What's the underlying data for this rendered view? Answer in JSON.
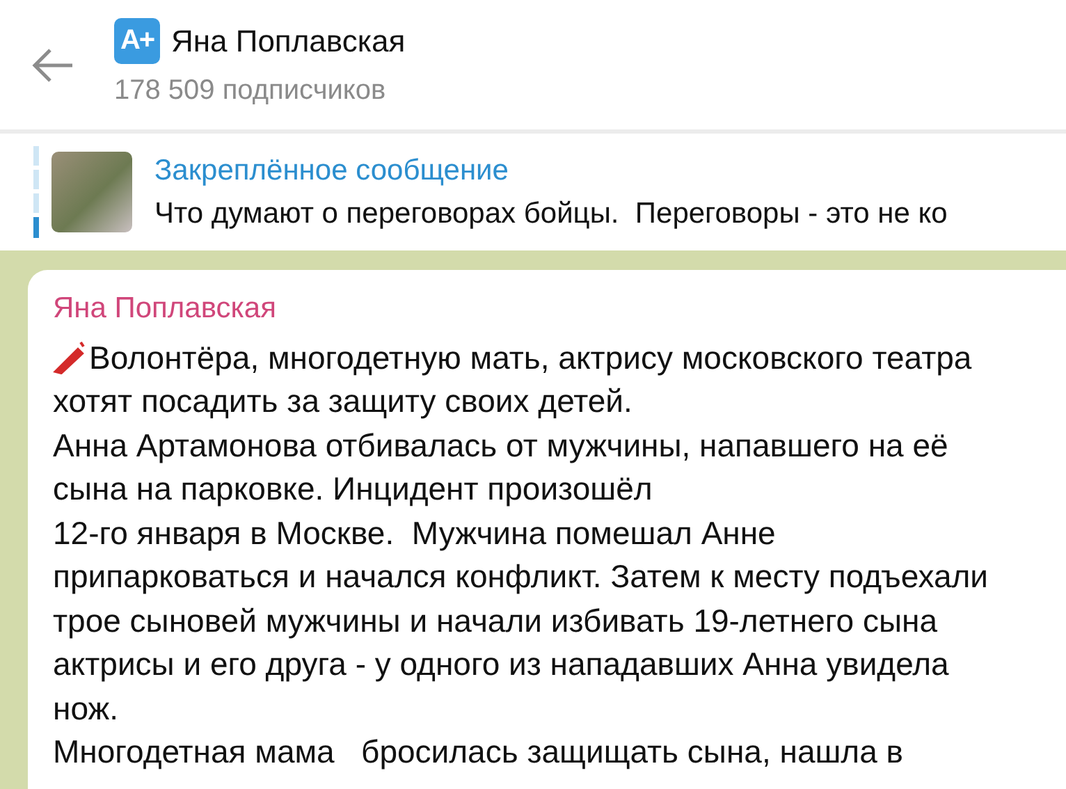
{
  "header": {
    "logo_text": "A+",
    "title": "Яна Поплавская",
    "subtitle": "178 509 подписчиков"
  },
  "pinned": {
    "label": "Закреплённое сообщение",
    "text": "Что думают о переговорах бойцы.  Переговоры - это не ко"
  },
  "message": {
    "author": "Яна Поплавская",
    "lines": [
      "Волонтёра, многодетную мать, актрису московского театра",
      "хотят посадить за защиту своих детей.",
      "Анна Артамонова отбивалась от мужчины, напавшего на её",
      "сына на парковке. Инцидент произошёл",
      "12-го января в Москве.  Мужчина помешал Анне",
      "припарковаться и начался конфликт. Затем к месту подъехали",
      "трое сыновей мужчины и начали избивать 19-летнего сына",
      "актрисы и его друга - у одного из нападавших Анна увидела",
      "нож.",
      "Многодетная мама   бросилась защищать сына, нашла в"
    ]
  }
}
